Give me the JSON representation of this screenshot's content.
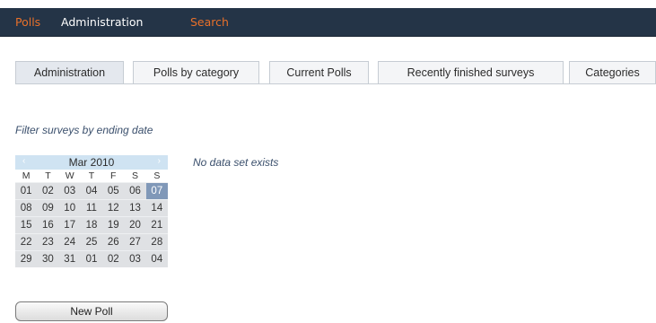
{
  "topnav": {
    "polls": "Polls",
    "administration": "Administration",
    "search": "Search",
    "colors": {
      "bar": "#243447",
      "accent": "#e8702a",
      "text": "#ffffff"
    }
  },
  "tabs": [
    {
      "label": "Administration",
      "active": true
    },
    {
      "label": "Polls by category",
      "active": false
    },
    {
      "label": "Current Polls",
      "active": false
    },
    {
      "label": "Recently finished surveys",
      "active": false
    },
    {
      "label": "Categories",
      "active": false
    }
  ],
  "filter_label": "Filter surveys by ending date",
  "calendar": {
    "prev_icon": "‹",
    "next_icon": "›",
    "title": "Mar 2010",
    "weekdays": [
      "M",
      "T",
      "W",
      "T",
      "F",
      "S",
      "S"
    ],
    "weeks": [
      [
        "01",
        "02",
        "03",
        "04",
        "05",
        "06",
        "07"
      ],
      [
        "08",
        "09",
        "10",
        "11",
        "12",
        "13",
        "14"
      ],
      [
        "15",
        "16",
        "17",
        "18",
        "19",
        "20",
        "21"
      ],
      [
        "22",
        "23",
        "24",
        "25",
        "26",
        "27",
        "28"
      ],
      [
        "29",
        "30",
        "31",
        "01",
        "02",
        "03",
        "04"
      ]
    ],
    "selected": "07"
  },
  "no_data": "No data set exists",
  "new_poll_label": "New Poll"
}
